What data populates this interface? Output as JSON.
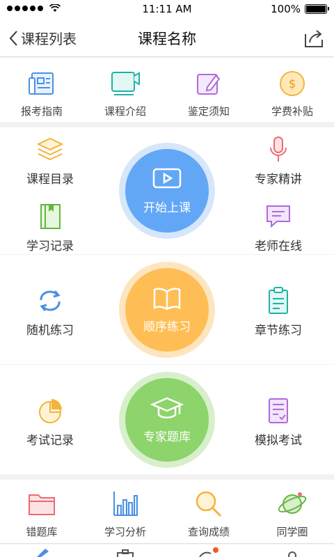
{
  "status_bar": {
    "time": "11:11 AM",
    "battery": "100%"
  },
  "nav": {
    "back_label": "课程列表",
    "title": "课程名称"
  },
  "quick_links": [
    {
      "label": "报考指南",
      "icon": "guide-icon"
    },
    {
      "label": "课程介绍",
      "icon": "course-intro-icon"
    },
    {
      "label": "鉴定须知",
      "icon": "notice-icon"
    },
    {
      "label": "学费补贴",
      "icon": "subsidy-icon"
    }
  ],
  "course": {
    "left_top": "课程目录",
    "left_bottom": "学习记录",
    "right_top": "专家精讲",
    "right_bottom": "老师在线",
    "center": "开始上课"
  },
  "practice": {
    "left": "随机练习",
    "right": "章节练习",
    "center": "顺序练习"
  },
  "exam": {
    "left": "考试记录",
    "right": "模拟考试",
    "center": "专家题库"
  },
  "tools": [
    {
      "label": "错题库",
      "icon": "mistakes-icon"
    },
    {
      "label": "学习分析",
      "icon": "analysis-icon"
    },
    {
      "label": "查询成绩",
      "icon": "search-icon"
    },
    {
      "label": "同学圈",
      "icon": "planet-icon"
    }
  ],
  "colors": {
    "blue": "#62a7f6",
    "orange": "#ffbe55",
    "green": "#8cd46b",
    "badge_red": "#f05a28"
  }
}
